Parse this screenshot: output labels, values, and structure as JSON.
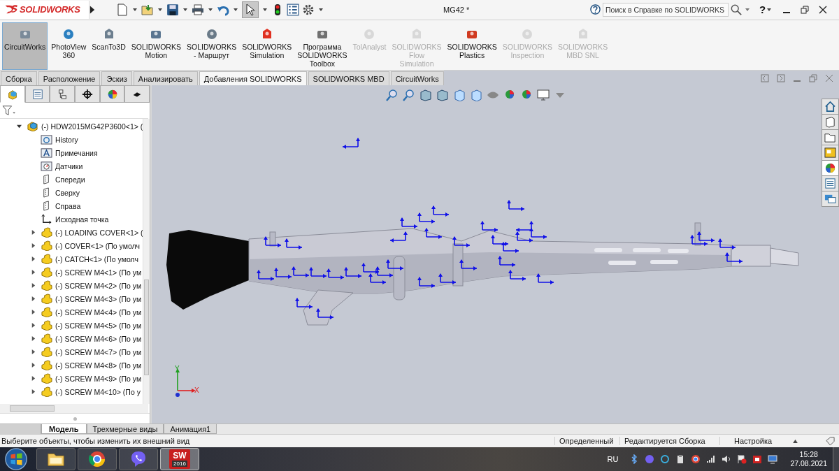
{
  "app": {
    "brand": "SOLIDWORKS",
    "title": "MG42 *",
    "search_placeholder": "Поиск в Справке по SOLIDWORKS",
    "help": "?"
  },
  "ribbon": [
    {
      "label": "CircuitWorks",
      "selected": true,
      "disabled": false
    },
    {
      "label": "PhotoView\n360",
      "selected": false,
      "disabled": false
    },
    {
      "label": "ScanTo3D",
      "selected": false,
      "disabled": false
    },
    {
      "label": "SOLIDWORKS\nMotion",
      "selected": false,
      "disabled": false
    },
    {
      "label": "SOLIDWORKS\n- Маршрут",
      "selected": false,
      "disabled": false
    },
    {
      "label": "SOLIDWORKS\nSimulation",
      "selected": false,
      "disabled": false
    },
    {
      "label": "Программа\nSOLIDWORKS\nToolbox",
      "selected": false,
      "disabled": false
    },
    {
      "label": "TolAnalyst",
      "selected": false,
      "disabled": true
    },
    {
      "label": "SOLIDWORKS\nFlow\nSimulation",
      "selected": false,
      "disabled": true
    },
    {
      "label": "SOLIDWORKS\nPlastics",
      "selected": false,
      "disabled": false
    },
    {
      "label": "SOLIDWORKS\nInspection",
      "selected": false,
      "disabled": true
    },
    {
      "label": "SOLIDWORKS\nMBD SNL",
      "selected": false,
      "disabled": true
    }
  ],
  "tabs": [
    {
      "label": "Сборка",
      "selected": false
    },
    {
      "label": "Расположение",
      "selected": false
    },
    {
      "label": "Эскиз",
      "selected": false
    },
    {
      "label": "Анализировать",
      "selected": false
    },
    {
      "label": "Добавления SOLIDWORKS",
      "selected": true
    },
    {
      "label": "SOLIDWORKS MBD",
      "selected": false
    },
    {
      "label": "CircuitWorks",
      "selected": false
    }
  ],
  "feature_manager": {
    "tabs": [
      {
        "selected": true
      },
      {
        "selected": false
      },
      {
        "selected": false
      },
      {
        "selected": false
      },
      {
        "selected": false
      },
      {
        "selected": false
      }
    ],
    "tree": [
      {
        "label": "(-) HDW2015MG42P3600<1> (",
        "kind": "assembly",
        "expanded": true,
        "children": [
          {
            "label": "History",
            "kind": "history"
          },
          {
            "label": "Примечания",
            "kind": "annotations"
          },
          {
            "label": "Датчики",
            "kind": "sensors"
          },
          {
            "label": "Спереди",
            "kind": "plane"
          },
          {
            "label": "Сверху",
            "kind": "plane"
          },
          {
            "label": "Справа",
            "kind": "plane"
          },
          {
            "label": "Исходная точка",
            "kind": "origin"
          },
          {
            "label": "(-) LOADING COVER<1> (",
            "kind": "part",
            "expanded": false
          },
          {
            "label": "(-) COVER<1> (По умолч",
            "kind": "part",
            "expanded": false
          },
          {
            "label": "(-) CATCH<1> (По умолч",
            "kind": "part",
            "expanded": false
          },
          {
            "label": "(-) SCREW M4<1> (По ум",
            "kind": "part",
            "expanded": false
          },
          {
            "label": "(-) SCREW M4<2> (По ум",
            "kind": "part",
            "expanded": false
          },
          {
            "label": "(-) SCREW M4<3> (По ум",
            "kind": "part",
            "expanded": false
          },
          {
            "label": "(-) SCREW M4<4> (По ум",
            "kind": "part",
            "expanded": false
          },
          {
            "label": "(-) SCREW M4<5> (По ум",
            "kind": "part",
            "expanded": false
          },
          {
            "label": "(-) SCREW M4<6> (По ум",
            "kind": "part",
            "expanded": false
          },
          {
            "label": "(-) SCREW M4<7> (По ум",
            "kind": "part",
            "expanded": false
          },
          {
            "label": "(-) SCREW M4<8> (По ум",
            "kind": "part",
            "expanded": false
          },
          {
            "label": "(-) SCREW M4<9> (По ум",
            "kind": "part",
            "expanded": false
          },
          {
            "label": "(-) SCREW M4<10> (По у",
            "kind": "part",
            "expanded": false
          }
        ]
      }
    ]
  },
  "viewport": {
    "axes": {
      "x": "X",
      "y": "Y"
    },
    "task_pane": [
      {
        "selected": false
      },
      {
        "selected": false
      },
      {
        "selected": false
      },
      {
        "selected": false
      },
      {
        "selected": true
      },
      {
        "selected": false
      },
      {
        "selected": false
      }
    ]
  },
  "bottom_tabs": [
    {
      "label": "Модель",
      "selected": true
    },
    {
      "label": "Трехмерные виды",
      "selected": false
    },
    {
      "label": "Анимация1",
      "selected": false
    }
  ],
  "status_bar": {
    "message": "Выберите объекты, чтобы изменить их внешний вид",
    "items": [
      "Определенный",
      "Редактируется Сборка",
      "Настройка"
    ]
  },
  "taskbar": {
    "apps": [
      {
        "kind": "folder",
        "active": false
      },
      {
        "kind": "browser",
        "active": false
      },
      {
        "kind": "messenger",
        "active": false
      },
      {
        "kind": "cad",
        "active": true,
        "logo": "SW",
        "label": "2016"
      }
    ],
    "language": "RU",
    "time": "15:28",
    "date": "27.08.2021"
  }
}
